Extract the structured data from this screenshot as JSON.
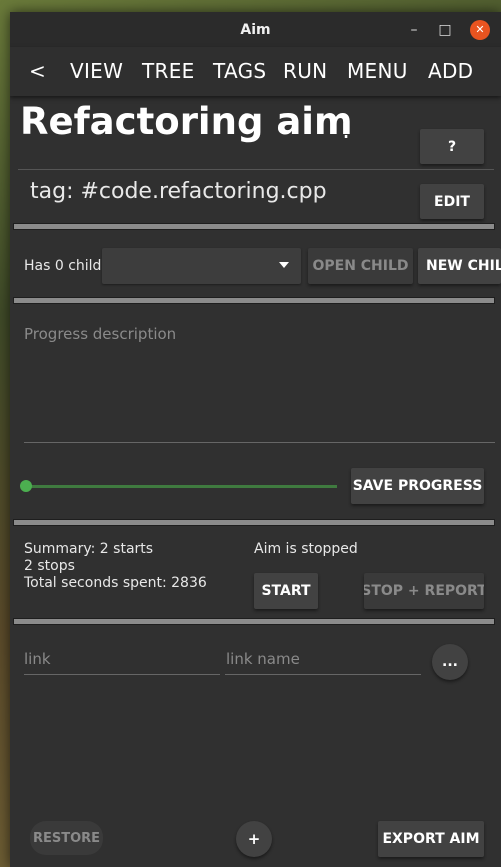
{
  "window": {
    "title": "Aim",
    "minimize_glyph": "–",
    "maximize_glyph": "□",
    "close_glyph": "✕"
  },
  "menu": {
    "back": "<",
    "items": [
      "VIEW",
      "TREE",
      "TAGS",
      "RUN",
      "MENU",
      "ADD"
    ]
  },
  "aim": {
    "name": "Refactoring aim",
    "name_suffix": ":",
    "help_label": "?",
    "tag": "tag: #code.refactoring.cpp",
    "edit_label": "EDIT"
  },
  "children": {
    "count_label": "Has 0 child",
    "selected": "",
    "open_child_label": "OPEN CHILD",
    "new_child_label": "NEW CHIL"
  },
  "progress": {
    "description_placeholder": "Progress description",
    "level": 0,
    "save_label": "SAVE PROGRESS"
  },
  "summary": {
    "line1": "Summary: 2 starts",
    "line2": "2 stops",
    "line3": "Total seconds spent: 2836",
    "status": "Aim is stopped",
    "start_label": "START",
    "stop_label": "STOP + REPORT"
  },
  "link": {
    "link_placeholder": "link",
    "name_placeholder": "link name",
    "more_label": "..."
  },
  "footer": {
    "restore_label": "RESTORE",
    "add_label": "+",
    "export_label": "EXPORT AIM"
  },
  "colors": {
    "accent": "#e95420",
    "slider": "#4caf50",
    "background": "#303030"
  }
}
